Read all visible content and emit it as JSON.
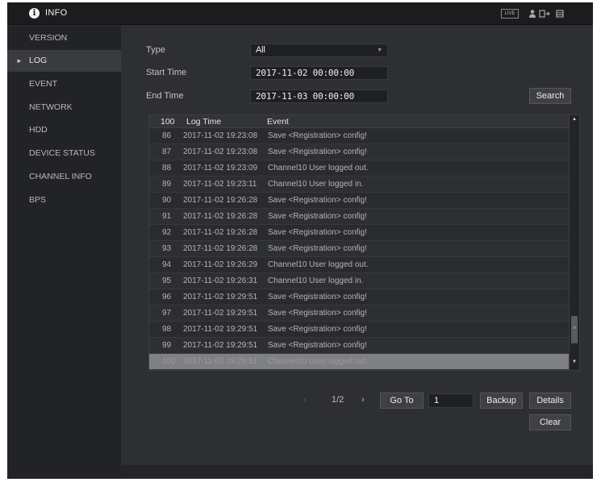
{
  "window": {
    "title": "INFO",
    "live_label": "LIVE"
  },
  "icons": {
    "info": "info-icon",
    "user": "user-icon",
    "exit": "logout-icon",
    "menu": "menu-icon",
    "sidebar_arrow": "chevron-right-icon",
    "dropdown": "chevron-down-icon",
    "prev": "chevron-left-icon",
    "next": "chevron-right-icon"
  },
  "sidebar": {
    "items": [
      {
        "label": "VERSION",
        "active": false
      },
      {
        "label": "LOG",
        "active": true
      },
      {
        "label": "EVENT",
        "active": false
      },
      {
        "label": "NETWORK",
        "active": false
      },
      {
        "label": "HDD",
        "active": false
      },
      {
        "label": "DEVICE STATUS",
        "active": false
      },
      {
        "label": "CHANNEL INFO",
        "active": false
      },
      {
        "label": "BPS",
        "active": false
      }
    ]
  },
  "filters": {
    "type_label": "Type",
    "type_value": "All",
    "start_label": "Start Time",
    "start_value": "2017-11-02  00:00:00",
    "end_label": "End Time",
    "end_value": "2017-11-03  00:00:00",
    "search_label": "Search"
  },
  "table": {
    "headers": {
      "no": "100",
      "time": "Log Time",
      "event": "Event"
    },
    "rows": [
      {
        "no": "86",
        "time": "2017-11-02 19:23:08",
        "event": "Save <Registration> config!"
      },
      {
        "no": "87",
        "time": "2017-11-02 19:23:08",
        "event": "Save <Registration> config!"
      },
      {
        "no": "88",
        "time": "2017-11-02 19:23:09",
        "event": "Channel10  User logged out."
      },
      {
        "no": "89",
        "time": "2017-11-02 19:23:11",
        "event": "Channel10  User logged in."
      },
      {
        "no": "90",
        "time": "2017-11-02 19:26:28",
        "event": "Save <Registration> config!"
      },
      {
        "no": "91",
        "time": "2017-11-02 19:26:28",
        "event": "Save <Registration> config!"
      },
      {
        "no": "92",
        "time": "2017-11-02 19:26:28",
        "event": "Save <Registration> config!"
      },
      {
        "no": "93",
        "time": "2017-11-02 19:26:28",
        "event": "Save <Registration> config!"
      },
      {
        "no": "94",
        "time": "2017-11-02 19:26:29",
        "event": "Channel10  User logged out."
      },
      {
        "no": "95",
        "time": "2017-11-02 19:26:31",
        "event": "Channel10  User logged in."
      },
      {
        "no": "96",
        "time": "2017-11-02 19:29:51",
        "event": "Save <Registration> config!"
      },
      {
        "no": "97",
        "time": "2017-11-02 19:29:51",
        "event": "Save <Registration> config!"
      },
      {
        "no": "98",
        "time": "2017-11-02 19:29:51",
        "event": "Save <Registration> config!"
      },
      {
        "no": "99",
        "time": "2017-11-02 19:29:51",
        "event": "Save <Registration> config!"
      },
      {
        "no": "100",
        "time": "2017-11-02 19:29:51",
        "event": "Channel10  User logged out.",
        "selected": true
      }
    ]
  },
  "pagination": {
    "page_text": "1/2",
    "goto_label": "Go To",
    "goto_value": "1"
  },
  "actions": {
    "backup_label": "Backup",
    "details_label": "Details",
    "clear_label": "Clear"
  },
  "colors": {
    "background": "#2e2f32",
    "sidebar": "#222326",
    "titlebar": "#1b1c1e",
    "selected_row": "#7f8084"
  }
}
